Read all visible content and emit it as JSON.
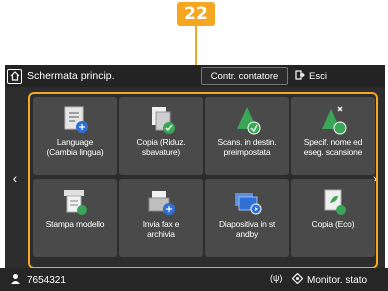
{
  "callout_number": "22",
  "header": {
    "title": "Schermata princip.",
    "counter_button": "Contr. contatore",
    "exit_button": "Esci"
  },
  "tiles": [
    {
      "label": "Language\n(Cambia lingua)",
      "icon": "language-icon"
    },
    {
      "label": "Copia (Riduz.\nsbavature)",
      "icon": "copy-icon"
    },
    {
      "label": "Scans. in destin.\npreimpostata",
      "icon": "scan-icon"
    },
    {
      "label": "Specif. nome ed\neseg. scansione",
      "icon": "scan-name-icon"
    },
    {
      "label": "Stampa modello",
      "icon": "template-print-icon"
    },
    {
      "label": "Invia fax e\narchivia",
      "icon": "fax-icon"
    },
    {
      "label": "Diapositiva in st\nandby",
      "icon": "slideshow-icon"
    },
    {
      "label": "Copia (Eco)",
      "icon": "eco-copy-icon"
    }
  ],
  "pagination": {
    "count": 4,
    "active_index": 2
  },
  "status": {
    "user_id": "7654321",
    "wifi_label": "(ψ)",
    "monitor_button": "Monitor. stato"
  },
  "colors": {
    "accent": "#f5a623",
    "green": "#3aa657",
    "blue": "#2f6fd6",
    "tile_bg": "#4a4a4a"
  }
}
